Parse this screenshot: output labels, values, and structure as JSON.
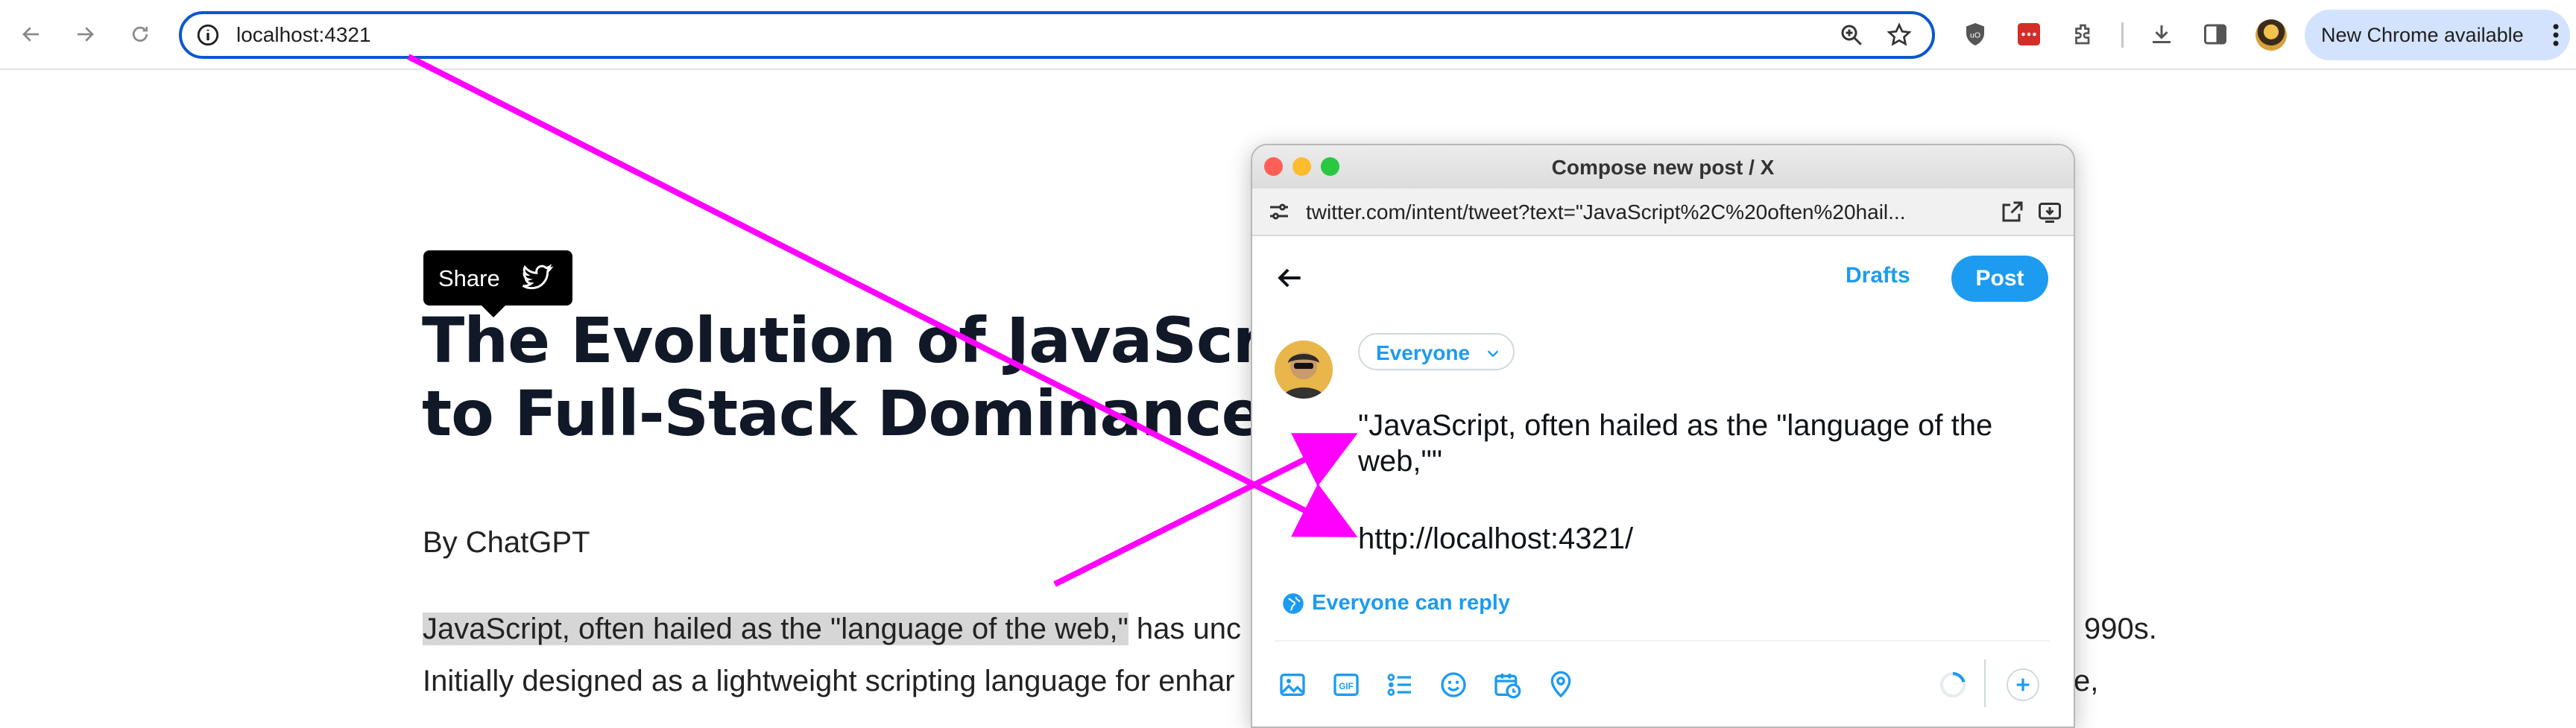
{
  "browser": {
    "url": "localhost:4321",
    "update_label": "New Chrome available"
  },
  "article": {
    "share_label": "Share",
    "title_line1": "The Evolution of JavaScrip",
    "title_line2": "to Full-Stack Dominance",
    "byline": "By ChatGPT",
    "para_highlight": "JavaScript, often hailed as the \"language of the web,\"",
    "para_rest": " has unc",
    "para_end": "990s.",
    "para_line2": "Initially designed as a lightweight scripting language for enhar",
    "para_line2_end": "e,"
  },
  "compose": {
    "window_title": "Compose new post / X",
    "url": "twitter.com/intent/tweet?text=\"JavaScript%2C%20often%20hail...",
    "drafts_label": "Drafts",
    "post_label": "Post",
    "audience_label": "Everyone",
    "tweet_text": "\"JavaScript, often hailed as the \"language of the web,\"\"",
    "tweet_url": "http://localhost:4321/",
    "reply_label": "Everyone can reply"
  },
  "colors": {
    "accent": "#1d9bf0",
    "annotation": "#ff00ff",
    "omnibox_border": "#0b57d0"
  },
  "icons": [
    "back-icon",
    "forward-icon",
    "reload-icon",
    "site-info-icon",
    "zoom-icon",
    "bookmark-star-icon",
    "ublock-icon",
    "lastpass-icon",
    "extensions-icon",
    "download-icon",
    "side-panel-icon",
    "twitter-bird-icon",
    "image-icon",
    "gif-icon",
    "poll-icon",
    "emoji-icon",
    "schedule-icon",
    "location-icon"
  ]
}
